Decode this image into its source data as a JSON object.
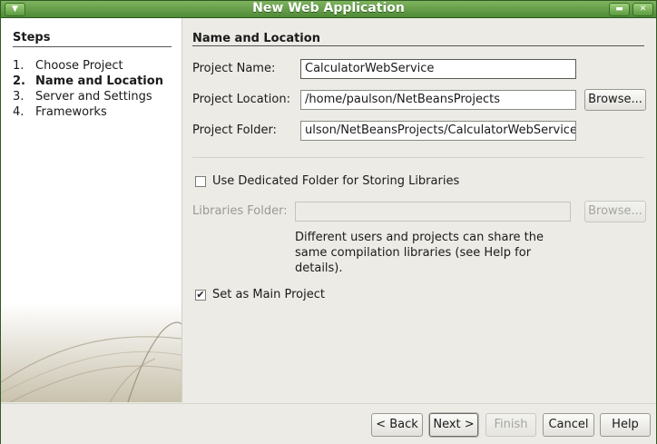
{
  "window": {
    "title": "New Web Application"
  },
  "steps": {
    "heading": "Steps",
    "items": [
      {
        "num": "1.",
        "label": "Choose Project",
        "current": false
      },
      {
        "num": "2.",
        "label": "Name and Location",
        "current": true
      },
      {
        "num": "3.",
        "label": "Server and Settings",
        "current": false
      },
      {
        "num": "4.",
        "label": "Frameworks",
        "current": false
      }
    ]
  },
  "section": {
    "title": "Name and Location"
  },
  "form": {
    "project_name": {
      "label": "Project Name:",
      "value": "CalculatorWebService"
    },
    "project_location": {
      "label": "Project Location:",
      "value": "/home/paulson/NetBeansProjects",
      "browse_label": "Browse..."
    },
    "project_folder": {
      "label": "Project Folder:",
      "value": "ulson/NetBeansProjects/CalculatorWebService"
    },
    "dedicated_folder": {
      "label": "Use Dedicated Folder for Storing Libraries",
      "checked": false
    },
    "libraries_folder": {
      "label": "Libraries Folder:",
      "value": "",
      "browse_label": "Browse..."
    },
    "libraries_note": "Different users and projects can share the same compilation libraries (see Help for details).",
    "main_project": {
      "label": "Set as Main Project",
      "checked": true
    }
  },
  "buttons": {
    "back": "< Back",
    "next": "Next >",
    "finish": "Finish",
    "cancel": "Cancel",
    "help": "Help"
  }
}
